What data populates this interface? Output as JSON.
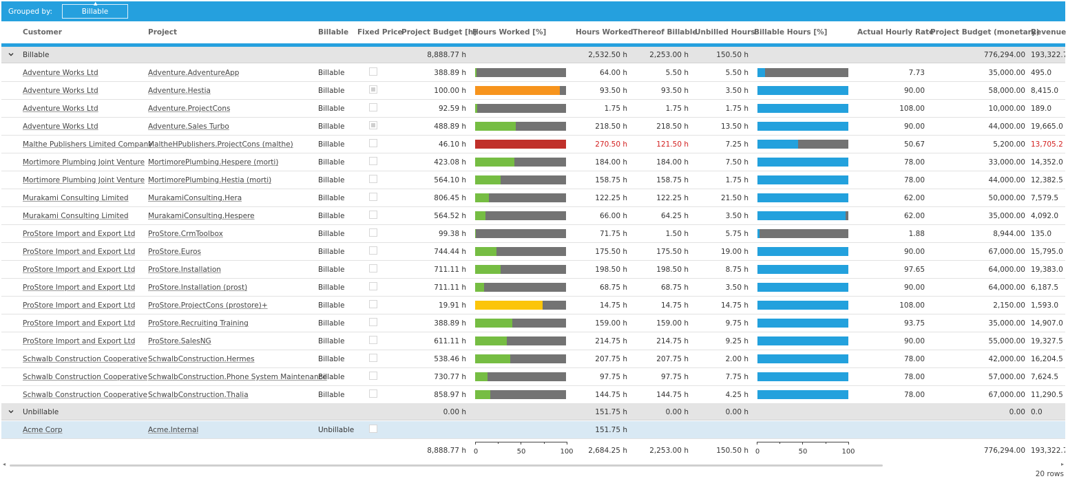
{
  "grouped_by_label": "Grouped by:",
  "group_chip": "Billable",
  "columns": {
    "customer": "Customer",
    "project": "Project",
    "billable": "Billable",
    "fixed_price": "Fixed Price",
    "project_budget_h": "Project Budget [h]",
    "hours_worked_pct": "Hours Worked [%]",
    "hours_worked": "Hours Worked",
    "thereof_billable": "Thereof Billable",
    "unbilled_hours": "Unbilled Hours",
    "billable_hours_pct": "Billable Hours [%]",
    "actual_hourly_rate": "Actual Hourly Rate",
    "project_budget_monetary": "Project Budget (monetary)",
    "revenue": "Revenue"
  },
  "colors": {
    "accent": "#25a0de",
    "bar_track": "#737373",
    "green": "#76bd43",
    "orange": "#f7941d",
    "red": "#c0302a",
    "yellow": "#fcc50a",
    "blue": "#23a1dd",
    "over_text": "#d32020"
  },
  "groups": [
    {
      "label": "Billable",
      "budget_h": "8,888.77 h",
      "hours_worked": "2,532.50 h",
      "thereof_billable": "2,253.00 h",
      "unbilled": "150.50 h",
      "budget_money": "776,294.00",
      "revenue": "193,322.7",
      "rows": [
        {
          "customer": "Adventure Works Ltd",
          "project": "Adventure.AdventureApp",
          "billable": "Billable",
          "fixed": false,
          "budget": "388.89 h",
          "hw_pct": 0.016,
          "hw_color": "green",
          "hours": "64.00 h",
          "thereof": "5.50 h",
          "unbilled": "5.50 h",
          "bh_pct": 0.086,
          "rate": "7.73",
          "budget_money": "35,000.00",
          "revenue": "495.0",
          "over": false
        },
        {
          "customer": "Adventure Works Ltd",
          "project": "Adventure.Hestia",
          "billable": "Billable",
          "fixed": true,
          "budget": "100.00 h",
          "hw_pct": 0.935,
          "hw_color": "orange",
          "hours": "93.50 h",
          "thereof": "93.50 h",
          "unbilled": "3.50 h",
          "bh_pct": 1.0,
          "rate": "90.00",
          "budget_money": "58,000.00",
          "revenue": "8,415.0",
          "over": false
        },
        {
          "customer": "Adventure Works Ltd",
          "project": "Adventure.ProjectCons",
          "billable": "Billable",
          "fixed": false,
          "budget": "92.59 h",
          "hw_pct": 0.019,
          "hw_color": "green",
          "hours": "1.75 h",
          "thereof": "1.75 h",
          "unbilled": "1.75 h",
          "bh_pct": 1.0,
          "rate": "108.00",
          "budget_money": "10,000.00",
          "revenue": "189.0",
          "over": false
        },
        {
          "customer": "Adventure Works Ltd",
          "project": "Adventure.Sales Turbo",
          "billable": "Billable",
          "fixed": true,
          "budget": "488.89 h",
          "hw_pct": 0.447,
          "hw_color": "green",
          "hours": "218.50 h",
          "thereof": "218.50 h",
          "unbilled": "13.50 h",
          "bh_pct": 1.0,
          "rate": "90.00",
          "budget_money": "44,000.00",
          "revenue": "19,665.0",
          "over": false
        },
        {
          "customer": "Malthe Publishers Limited Company",
          "project": "MaltheHPublishers.ProjectCons (malthe)",
          "billable": "Billable",
          "fixed": false,
          "budget": "46.10 h",
          "hw_pct": 1.0,
          "hw_color": "red",
          "hours": "270.50 h",
          "thereof": "121.50 h",
          "unbilled": "7.25 h",
          "bh_pct": 0.449,
          "rate": "50.67",
          "budget_money": "5,200.00",
          "revenue": "13,705.2",
          "over": true
        },
        {
          "customer": "Mortimore Plumbing Joint Venture",
          "project": "MortimorePlumbing.Hespere (morti)",
          "billable": "Billable",
          "fixed": false,
          "budget": "423.08 h",
          "hw_pct": 0.435,
          "hw_color": "green",
          "hours": "184.00 h",
          "thereof": "184.00 h",
          "unbilled": "7.50 h",
          "bh_pct": 1.0,
          "rate": "78.00",
          "budget_money": "33,000.00",
          "revenue": "14,352.0",
          "over": false
        },
        {
          "customer": "Mortimore Plumbing Joint Venture",
          "project": "MortimorePlumbing.Hestia (morti)",
          "billable": "Billable",
          "fixed": false,
          "budget": "564.10 h",
          "hw_pct": 0.281,
          "hw_color": "green",
          "hours": "158.75 h",
          "thereof": "158.75 h",
          "unbilled": "1.75 h",
          "bh_pct": 1.0,
          "rate": "78.00",
          "budget_money": "44,000.00",
          "revenue": "12,382.5",
          "over": false
        },
        {
          "customer": "Murakami Consulting Limited",
          "project": "MurakamiConsulting.Hera",
          "billable": "Billable",
          "fixed": false,
          "budget": "806.45 h",
          "hw_pct": 0.152,
          "hw_color": "green",
          "hours": "122.25 h",
          "thereof": "122.25 h",
          "unbilled": "21.50 h",
          "bh_pct": 1.0,
          "rate": "62.00",
          "budget_money": "50,000.00",
          "revenue": "7,579.5",
          "over": false
        },
        {
          "customer": "Murakami Consulting Limited",
          "project": "MurakamiConsulting.Hespere",
          "billable": "Billable",
          "fixed": false,
          "budget": "564.52 h",
          "hw_pct": 0.117,
          "hw_color": "green",
          "hours": "66.00 h",
          "thereof": "64.25 h",
          "unbilled": "3.50 h",
          "bh_pct": 0.973,
          "rate": "62.00",
          "budget_money": "35,000.00",
          "revenue": "4,092.0",
          "over": false
        },
        {
          "customer": "ProStore Import and Export Ltd",
          "project": "ProStore.CrmToolbox",
          "billable": "Billable",
          "fixed": false,
          "budget": "99.38 h",
          "hw_pct": 0.0,
          "hw_color": "green",
          "hours": "71.75 h",
          "thereof": "1.50 h",
          "unbilled": "5.75 h",
          "bh_pct": 0.021,
          "rate": "1.88",
          "budget_money": "8,944.00",
          "revenue": "135.0",
          "over": false
        },
        {
          "customer": "ProStore Import and Export Ltd",
          "project": "ProStore.Euros",
          "billable": "Billable",
          "fixed": false,
          "budget": "744.44 h",
          "hw_pct": 0.236,
          "hw_color": "green",
          "hours": "175.50 h",
          "thereof": "175.50 h",
          "unbilled": "19.00 h",
          "bh_pct": 1.0,
          "rate": "90.00",
          "budget_money": "67,000.00",
          "revenue": "15,795.0",
          "over": false
        },
        {
          "customer": "ProStore Import and Export Ltd",
          "project": "ProStore.Installation",
          "billable": "Billable",
          "fixed": false,
          "budget": "711.11 h",
          "hw_pct": 0.279,
          "hw_color": "green",
          "hours": "198.50 h",
          "thereof": "198.50 h",
          "unbilled": "8.75 h",
          "bh_pct": 1.0,
          "rate": "97.65",
          "budget_money": "64,000.00",
          "revenue": "19,383.0",
          "over": false
        },
        {
          "customer": "ProStore Import and Export Ltd",
          "project": "ProStore.Installation (prost)",
          "billable": "Billable",
          "fixed": false,
          "budget": "711.11 h",
          "hw_pct": 0.097,
          "hw_color": "green",
          "hours": "68.75 h",
          "thereof": "68.75 h",
          "unbilled": "3.50 h",
          "bh_pct": 1.0,
          "rate": "90.00",
          "budget_money": "64,000.00",
          "revenue": "6,187.5",
          "over": false
        },
        {
          "customer": "ProStore Import and Export Ltd",
          "project": "ProStore.ProjectCons (prostore)+",
          "billable": "Billable",
          "fixed": false,
          "budget": "19.91 h",
          "hw_pct": 0.741,
          "hw_color": "yellow",
          "hours": "14.75 h",
          "thereof": "14.75 h",
          "unbilled": "14.75 h",
          "bh_pct": 1.0,
          "rate": "108.00",
          "budget_money": "2,150.00",
          "revenue": "1,593.0",
          "over": false
        },
        {
          "customer": "ProStore Import and Export Ltd",
          "project": "ProStore.Recruiting Training",
          "billable": "Billable",
          "fixed": false,
          "budget": "388.89 h",
          "hw_pct": 0.409,
          "hw_color": "green",
          "hours": "159.00 h",
          "thereof": "159.00 h",
          "unbilled": "9.75 h",
          "bh_pct": 1.0,
          "rate": "93.75",
          "budget_money": "35,000.00",
          "revenue": "14,907.0",
          "over": false
        },
        {
          "customer": "ProStore Import and Export Ltd",
          "project": "ProStore.SalesNG",
          "billable": "Billable",
          "fixed": false,
          "budget": "611.11 h",
          "hw_pct": 0.351,
          "hw_color": "green",
          "hours": "214.75 h",
          "thereof": "214.75 h",
          "unbilled": "9.25 h",
          "bh_pct": 1.0,
          "rate": "90.00",
          "budget_money": "55,000.00",
          "revenue": "19,327.5",
          "over": false
        },
        {
          "customer": "Schwalb Construction Cooperative",
          "project": "SchwalbConstruction.Hermes",
          "billable": "Billable",
          "fixed": false,
          "budget": "538.46 h",
          "hw_pct": 0.385,
          "hw_color": "green",
          "hours": "207.75 h",
          "thereof": "207.75 h",
          "unbilled": "2.00 h",
          "bh_pct": 1.0,
          "rate": "78.00",
          "budget_money": "42,000.00",
          "revenue": "16,204.5",
          "over": false
        },
        {
          "customer": "Schwalb Construction Cooperative",
          "project": "SchwalbConstruction.Phone System Maintenance",
          "billable": "Billable",
          "fixed": false,
          "budget": "730.77 h",
          "hw_pct": 0.134,
          "hw_color": "green",
          "hours": "97.75 h",
          "thereof": "97.75 h",
          "unbilled": "7.75 h",
          "bh_pct": 1.0,
          "rate": "78.00",
          "budget_money": "57,000.00",
          "revenue": "7,624.5",
          "over": false
        },
        {
          "customer": "Schwalb Construction Cooperative",
          "project": "SchwalbConstruction.Thalia",
          "billable": "Billable",
          "fixed": false,
          "budget": "858.97 h",
          "hw_pct": 0.168,
          "hw_color": "green",
          "hours": "144.75 h",
          "thereof": "144.75 h",
          "unbilled": "4.25 h",
          "bh_pct": 1.0,
          "rate": "78.00",
          "budget_money": "67,000.00",
          "revenue": "11,290.5",
          "over": false
        }
      ]
    },
    {
      "label": "Unbillable",
      "budget_h": "0.00 h",
      "hours_worked": "151.75 h",
      "thereof_billable": "0.00 h",
      "unbilled": "0.00 h",
      "budget_money": "0.00",
      "revenue": "0.0",
      "rows": [
        {
          "customer": "Acme Corp",
          "project": "Acme.Internal",
          "billable": "Unbillable",
          "fixed": false,
          "budget": "",
          "hw_pct": null,
          "hw_color": "green",
          "hours": "151.75 h",
          "thereof": "",
          "unbilled": "",
          "bh_pct": null,
          "rate": "",
          "budget_money": "",
          "revenue": "",
          "over": false,
          "selected": true
        }
      ]
    }
  ],
  "totals": {
    "budget_h": "8,888.77 h",
    "hours_worked": "2,684.25 h",
    "thereof_billable": "2,253.00 h",
    "unbilled": "150.50 h",
    "budget_money": "776,294.00",
    "revenue": "193,322.7",
    "axis_ticks": [
      "0",
      "50",
      "100"
    ]
  },
  "row_count": "20 rows"
}
